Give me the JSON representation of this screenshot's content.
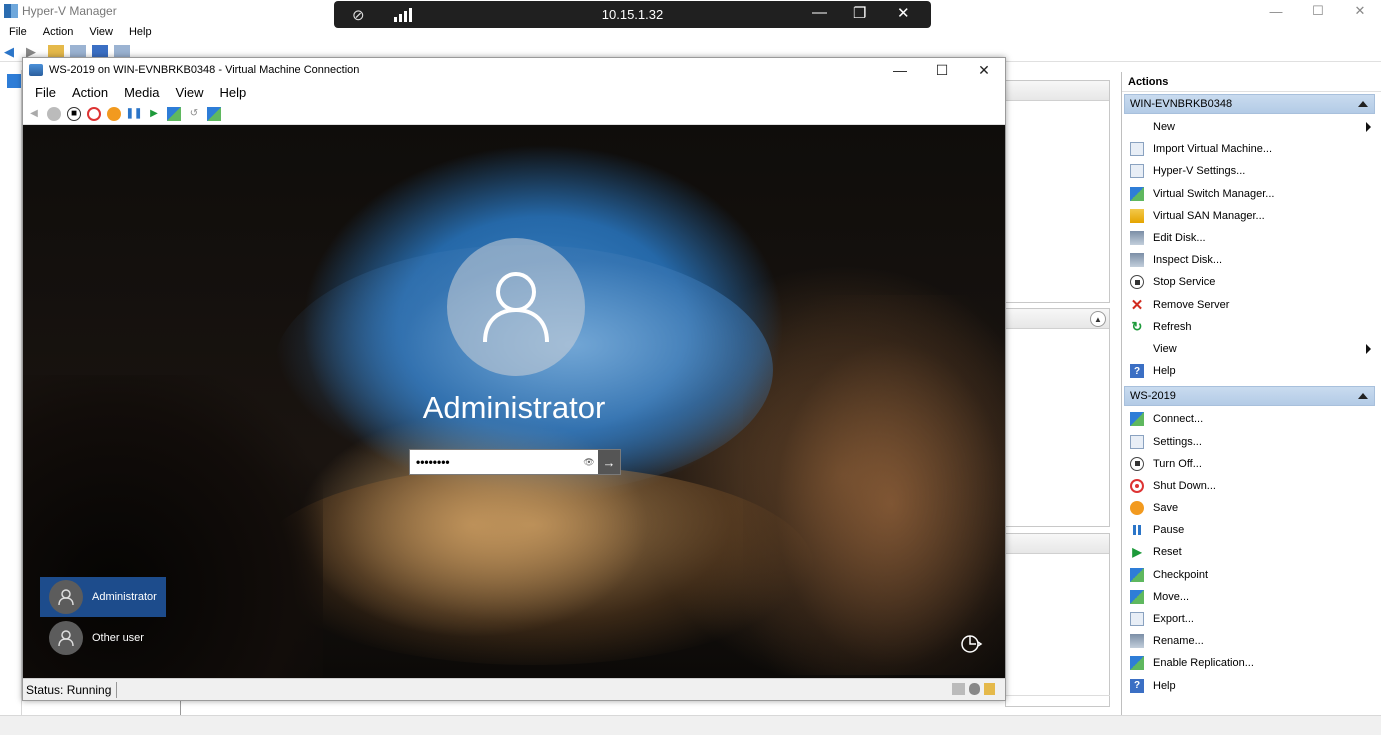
{
  "hyperv": {
    "title": "Hyper-V Manager",
    "menu": [
      "File",
      "Action",
      "View",
      "Help"
    ],
    "window_controls": {
      "minimize": "—",
      "maximize": "☐",
      "close": "✕"
    }
  },
  "remote_bar": {
    "address": "10.15.1.32",
    "controls": {
      "minimize": "—",
      "restore": "❐",
      "close": "✕"
    }
  },
  "vm_window": {
    "title": "WS-2019 on WIN-EVNBRKB0348 - Virtual Machine Connection",
    "menu": [
      "File",
      "Action",
      "Media",
      "View",
      "Help"
    ],
    "window_controls": {
      "minimize": "—",
      "maximize": "☐",
      "close": "✕"
    },
    "status": "Status: Running"
  },
  "login_screen": {
    "user_name": "Administrator",
    "password_value": "••••••••",
    "users": [
      {
        "name": "Administrator",
        "selected": true
      },
      {
        "name": "Other user",
        "selected": false
      }
    ]
  },
  "actions": {
    "title": "Actions",
    "groups": [
      {
        "header": "WIN-EVNBRKB0348",
        "items": [
          {
            "label": "New",
            "icon": "none",
            "submenu": true
          },
          {
            "label": "Import Virtual Machine...",
            "icon": "import-vm-icon"
          },
          {
            "label": "Hyper-V Settings...",
            "icon": "settings-doc-icon"
          },
          {
            "label": "Virtual Switch Manager...",
            "icon": "switch-manager-icon"
          },
          {
            "label": "Virtual SAN Manager...",
            "icon": "san-manager-icon"
          },
          {
            "label": "Edit Disk...",
            "icon": "edit-disk-icon"
          },
          {
            "label": "Inspect Disk...",
            "icon": "inspect-disk-icon"
          },
          {
            "label": "Stop Service",
            "icon": "stop-icon"
          },
          {
            "label": "Remove Server",
            "icon": "remove-x-icon"
          },
          {
            "label": "Refresh",
            "icon": "refresh-icon"
          },
          {
            "label": "View",
            "icon": "none",
            "submenu": true
          },
          {
            "label": "Help",
            "icon": "help-icon"
          }
        ]
      },
      {
        "header": "WS-2019",
        "items": [
          {
            "label": "Connect...",
            "icon": "connect-icon"
          },
          {
            "label": "Settings...",
            "icon": "settings-icon"
          },
          {
            "label": "Turn Off...",
            "icon": "turn-off-icon"
          },
          {
            "label": "Shut Down...",
            "icon": "shut-down-icon"
          },
          {
            "label": "Save",
            "icon": "save-icon"
          },
          {
            "label": "Pause",
            "icon": "pause-icon"
          },
          {
            "label": "Reset",
            "icon": "reset-icon"
          },
          {
            "label": "Checkpoint",
            "icon": "checkpoint-icon"
          },
          {
            "label": "Move...",
            "icon": "move-icon"
          },
          {
            "label": "Export...",
            "icon": "export-icon"
          },
          {
            "label": "Rename...",
            "icon": "rename-icon"
          },
          {
            "label": "Enable Replication...",
            "icon": "replication-icon"
          },
          {
            "label": "Help",
            "icon": "help-icon"
          }
        ]
      }
    ]
  },
  "colors": {
    "actions_header_bg": "#b9cfe8",
    "selected_user_tile": "#1d4c8c",
    "remote_bar_bg": "#202020"
  }
}
